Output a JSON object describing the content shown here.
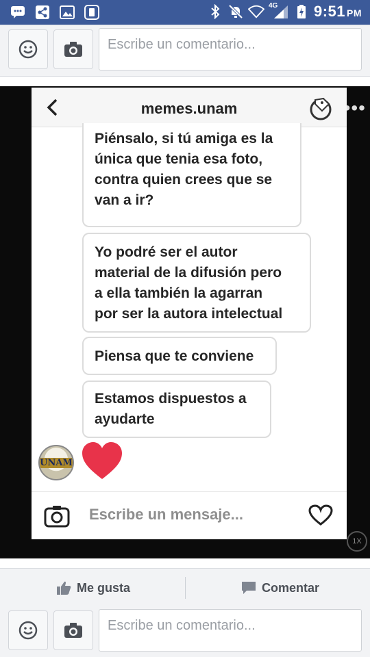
{
  "status_bar": {
    "time": "9:51",
    "ampm": "PM",
    "network": "4G",
    "left_icons": [
      "messenger-icon",
      "share-icon",
      "gallery-icon",
      "notification-icon"
    ],
    "right_icons": [
      "bluetooth-icon",
      "mute-icon",
      "wifi-icon",
      "signal-icon",
      "battery-charging-icon"
    ]
  },
  "comment_box_top": {
    "placeholder": "Escribe un comentario..."
  },
  "post_image": {
    "chat": {
      "title": "memes.unam",
      "messages": [
        "Piénsalo, si tú amiga es la\núnica que tenia esa foto,\ncontra quien crees que se\nvan a ir?",
        "Yo podré ser el autor\nmaterial de la difusión pero\na ella también la agarran\npor ser la autora intelectual",
        "Piensa que te conviene",
        "Estamos dispuestos a\nayudarte"
      ],
      "avatar_text": "UNAM",
      "input_placeholder": "Escribe un mensaje..."
    },
    "zoom_badge": "1X"
  },
  "actions": {
    "like_label": "Me gusta",
    "comment_label": "Comentar"
  },
  "comment_box_bottom": {
    "placeholder": "Escribe un comentario..."
  },
  "colors": {
    "status_bar": "#3c5a99",
    "heart": "#e8334a",
    "bar_bg": "#f2f3f5"
  }
}
